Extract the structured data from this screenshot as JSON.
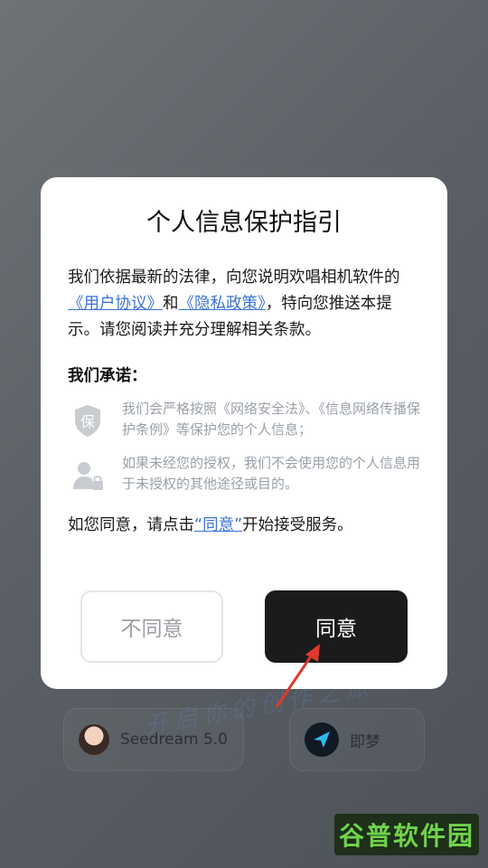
{
  "background": {
    "slogan": "开启你的创作之旅",
    "models": [
      {
        "label": "Seedream 5.0",
        "icon": "avatar-icon"
      },
      {
        "label": "即梦",
        "icon": "jimeng-logo-icon"
      }
    ],
    "watermark": "谷普软件园"
  },
  "dialog": {
    "title": "个人信息保护指引",
    "intro_part1": "我们依据最新的法律，向您说明欢唱相机软件的",
    "link_user_agreement": "《用户协议》",
    "intro_and": "和",
    "link_privacy_policy": "《隐私政策》",
    "intro_part2": "，特向您推送本提示。请您阅读并充分理解相关条款。",
    "promise_heading": "我们承诺：",
    "promises": [
      {
        "icon": "shield-icon",
        "text": "我们会严格按照《网络安全法》、《信息网络传播保护条例》等保护您的个人信息；"
      },
      {
        "icon": "user-lock-icon",
        "text": "如果未经您的授权，我们不会使用您的个人信息用于未授权的其他途径或目的。"
      }
    ],
    "agree_prefix": "如您同意，请点击",
    "agree_link": "“同意”",
    "agree_suffix": "开始接受服务。",
    "decline_label": "不同意",
    "accept_label": "同意"
  },
  "colors": {
    "accent_link": "#3a73d6",
    "accept_button": "#1b1b1b",
    "arrow": "#e0382e"
  }
}
